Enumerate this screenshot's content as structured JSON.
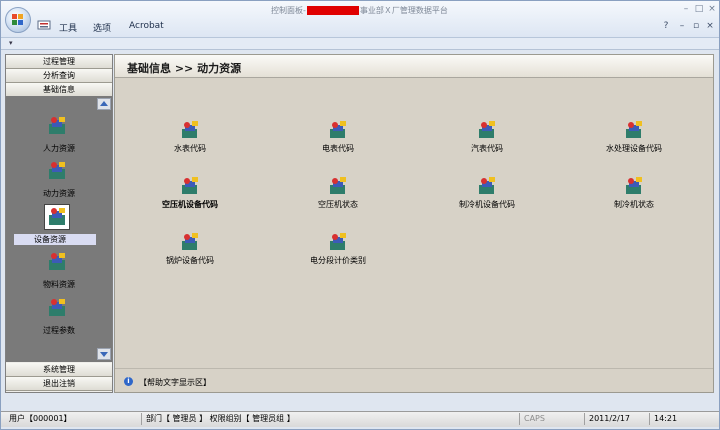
{
  "titlebar": {
    "title_prefix": "控制面板-",
    "title_suffix": "事业部Ｘ厂管理数据平台",
    "menu": [
      "工具",
      "选项",
      "Acrobat"
    ]
  },
  "nav": {
    "top_sections": [
      "过程管理",
      "分析查询",
      "基础信息"
    ],
    "items": [
      {
        "label": "人力资源"
      },
      {
        "label": "动力资源"
      },
      {
        "label": "设备资源"
      },
      {
        "label": "物料资源"
      },
      {
        "label": "过程参数"
      }
    ],
    "bottom_sections": [
      "系统管理",
      "退出注销"
    ]
  },
  "main": {
    "breadcrumb": "基础信息 >> 动力资源",
    "tiles": [
      {
        "label": "水表代码"
      },
      {
        "label": "电表代码"
      },
      {
        "label": "汽表代码"
      },
      {
        "label": "水处理设备代码"
      },
      {
        "label": "空压机设备代码"
      },
      {
        "label": "空压机状态"
      },
      {
        "label": "制冷机设备代码"
      },
      {
        "label": "制冷机状态"
      },
      {
        "label": "锅炉设备代码"
      },
      {
        "label": "电分段计价类别"
      }
    ],
    "help_text": "【帮助文字显示区】"
  },
  "status": {
    "user": "用户【000001】",
    "dept": "部门【 管理员 】 权限组别【 管理员组 】",
    "caps": "CAPS",
    "date": "2011/2/17",
    "time": "14:21"
  },
  "colors": {
    "accent": "#2f67c9",
    "redaction": "#e00000"
  }
}
